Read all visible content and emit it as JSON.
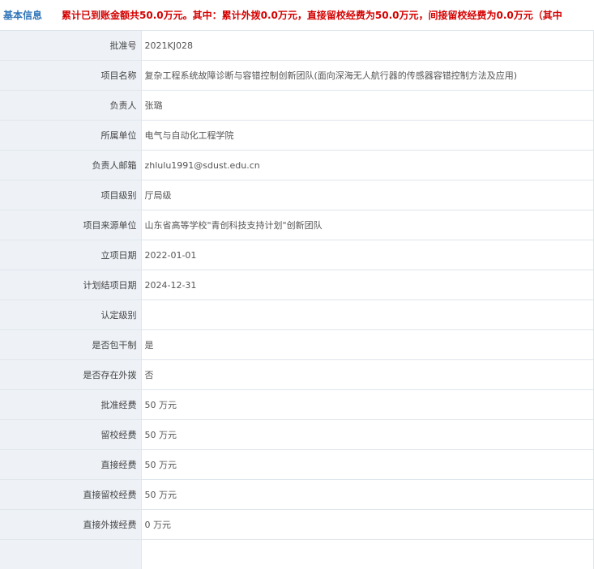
{
  "header": {
    "title": "基本信息",
    "summary": "累计已到账金额共50.0万元。其中：累计外拨0.0万元，直接留校经费为50.0万元，间接留校经费为0.0万元（其中"
  },
  "rows": [
    {
      "label": "批准号",
      "value": "2021KJ028"
    },
    {
      "label": "项目名称",
      "value": "复杂工程系统故障诊断与容错控制创新团队(面向深海无人航行器的传感器容错控制方法及应用)"
    },
    {
      "label": "负责人",
      "value": "张璐"
    },
    {
      "label": "所属单位",
      "value": "电气与自动化工程学院"
    },
    {
      "label": "负责人邮箱",
      "value": "zhlulu1991@sdust.edu.cn"
    },
    {
      "label": "项目级别",
      "value": "厅局级"
    },
    {
      "label": "项目来源单位",
      "value": "山东省高等学校\"青创科技支持计划\"创新团队"
    },
    {
      "label": "立项日期",
      "value": "2022-01-01"
    },
    {
      "label": "计划结项日期",
      "value": "2024-12-31"
    },
    {
      "label": "认定级别",
      "value": ""
    },
    {
      "label": "是否包干制",
      "value": "是"
    },
    {
      "label": "是否存在外拨",
      "value": "否"
    },
    {
      "label": "批准经费",
      "value": "50  万元"
    },
    {
      "label": "留校经费",
      "value": "50  万元"
    },
    {
      "label": "直接经费",
      "value": "50  万元"
    },
    {
      "label": "直接留校经费",
      "value": "50  万元"
    },
    {
      "label": "直接外拨经费",
      "value": "0  万元"
    },
    {
      "label": "",
      "value": ""
    }
  ]
}
